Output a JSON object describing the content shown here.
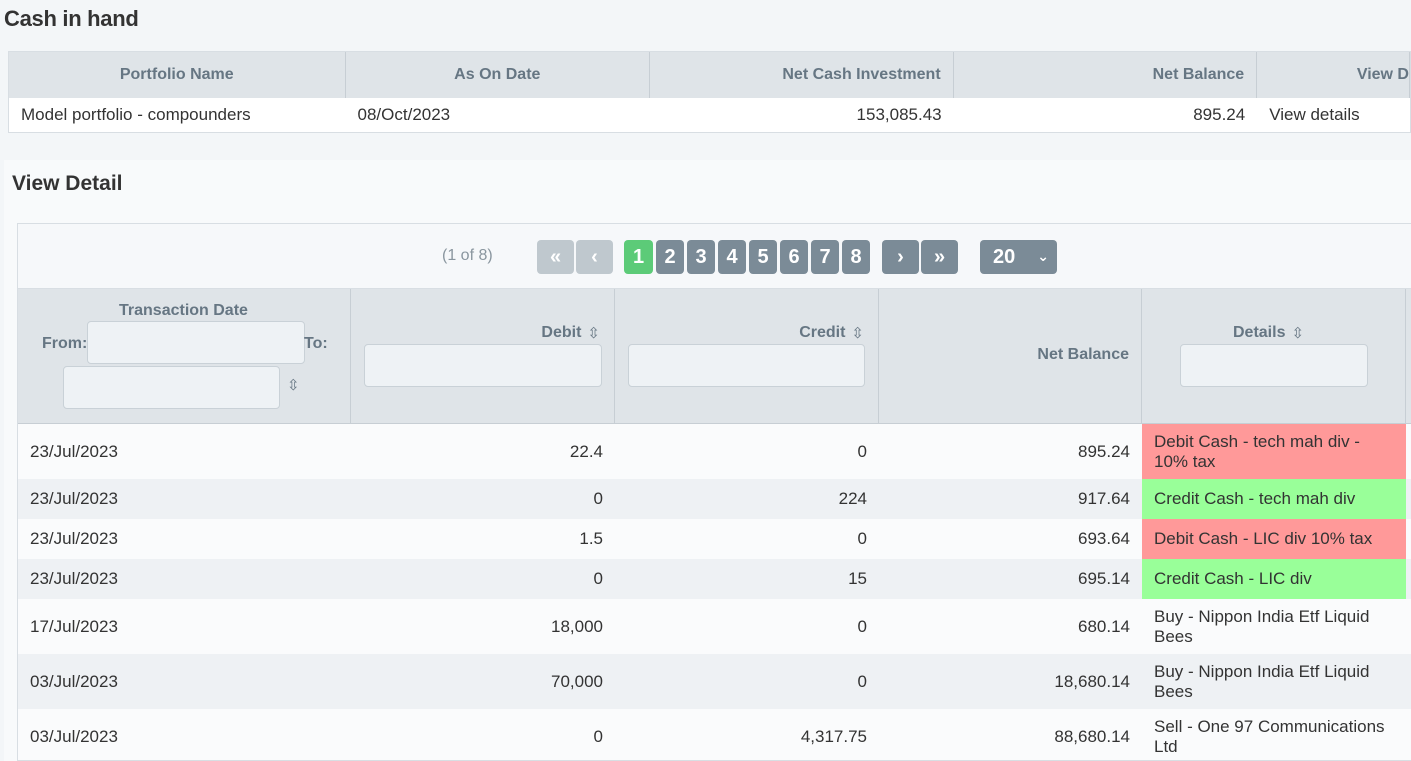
{
  "page_title": "Cash in hand",
  "summary": {
    "headers": [
      "Portfolio Name",
      "As On Date",
      "Net Cash Investment",
      "Net Balance",
      "View D"
    ],
    "row": {
      "portfolio_name": "Model portfolio - compounders",
      "as_on_date": "08/Oct/2023",
      "net_cash_investment": "153,085.43",
      "net_balance": "895.24",
      "view_link": "View details"
    }
  },
  "detail": {
    "title": "View Detail",
    "pager": {
      "status": "(1 of 8)",
      "first": "«",
      "prev": "‹",
      "pages": [
        "1",
        "2",
        "3",
        "4",
        "5",
        "6",
        "7",
        "8"
      ],
      "current_page": "1",
      "next": "›",
      "last": "»",
      "rows_per_page": "20"
    },
    "columns": {
      "date": "Transaction Date",
      "from": "From:",
      "to": "To:",
      "debit": "Debit",
      "credit": "Credit",
      "net_balance": "Net Balance",
      "details": "Details"
    },
    "rows": [
      {
        "date": "23/Jul/2023",
        "debit": "22.4",
        "credit": "0",
        "balance": "895.24",
        "details": "Debit Cash - tech mah div - 10% tax",
        "kind": "debit"
      },
      {
        "date": "23/Jul/2023",
        "debit": "0",
        "credit": "224",
        "balance": "917.64",
        "details": "Credit Cash - tech mah div",
        "kind": "credit"
      },
      {
        "date": "23/Jul/2023",
        "debit": "1.5",
        "credit": "0",
        "balance": "693.64",
        "details": "Debit Cash - LIC div 10% tax",
        "kind": "debit"
      },
      {
        "date": "23/Jul/2023",
        "debit": "0",
        "credit": "15",
        "balance": "695.14",
        "details": "Credit Cash - LIC div",
        "kind": "credit"
      },
      {
        "date": "17/Jul/2023",
        "debit": "18,000",
        "credit": "0",
        "balance": "680.14",
        "details": "Buy - Nippon India Etf Liquid Bees",
        "kind": "none"
      },
      {
        "date": "03/Jul/2023",
        "debit": "70,000",
        "credit": "0",
        "balance": "18,680.14",
        "details": "Buy - Nippon India Etf Liquid Bees",
        "kind": "none"
      },
      {
        "date": "03/Jul/2023",
        "debit": "0",
        "credit": "4,317.75",
        "balance": "88,680.14",
        "details": "Sell - One 97 Communications Ltd",
        "kind": "none"
      }
    ]
  }
}
